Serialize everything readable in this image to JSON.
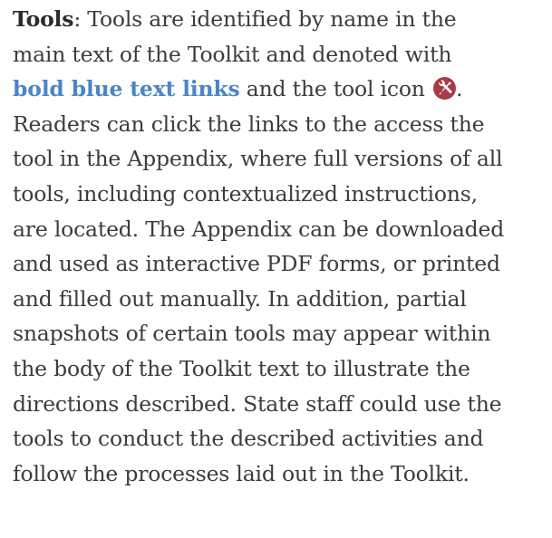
{
  "paragraph": {
    "line1": {
      "term": "Tools",
      "after_term": ": Tools are identified by name in the"
    },
    "line2": "main text of the Toolkit and denoted with",
    "line3": {
      "link_text": "bold blue text links",
      "after_link": " and the tool icon ",
      "after_icon": "."
    },
    "line4": "Readers can click the links to the access the",
    "line5": "tool in the Appendix, where full versions of all",
    "line6": "tools, including contextualized instructions,",
    "line7": "are located. The Appendix can be downloaded",
    "line8": "and used as interactive PDF forms, or printed",
    "line9": "and filled out manually. In addition, partial",
    "line10": "snapshots of certain tools may appear within",
    "line11": "the body of the Toolkit text to illustrate the",
    "line12": "directions described. State staff could use the",
    "line13": "tools to conduct the described activities and",
    "line14": "follow the processes laid out in the Toolkit."
  },
  "icon": {
    "name": "tools-icon",
    "color": "#a83a4a"
  },
  "colors": {
    "body_text": "#3c3c3c",
    "link": "#4a86c5",
    "background": "#ffffff"
  }
}
